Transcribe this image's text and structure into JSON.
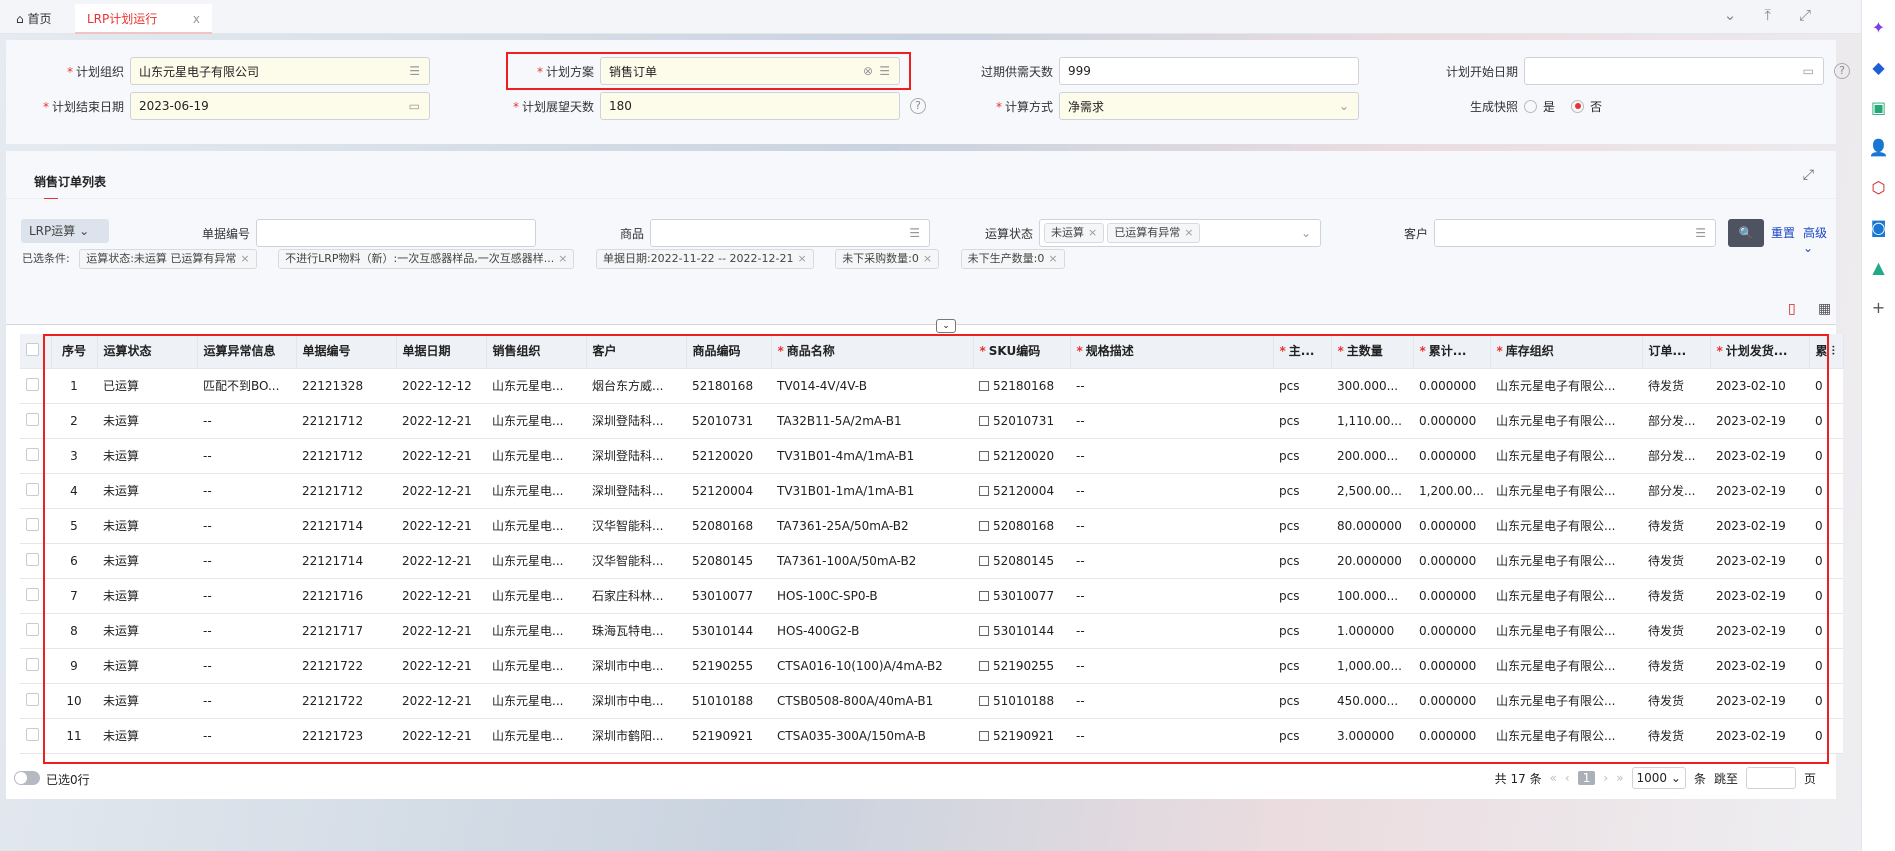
{
  "tabs": {
    "home": "首页",
    "active": "LRP计划运行",
    "close": "x"
  },
  "form": {
    "org_label": "计划组织",
    "org_value": "山东元星电子有限公司",
    "scheme_label": "计划方案",
    "scheme_value": "销售订单",
    "overdue_label": "过期供需天数",
    "overdue_value": "999",
    "start_label": "计划开始日期",
    "start_value": "",
    "end_label": "计划结束日期",
    "end_value": "2023-06-19",
    "horizon_label": "计划展望天数",
    "horizon_value": "180",
    "method_label": "计算方式",
    "method_value": "净需求",
    "snapshot_label": "生成快照",
    "yes": "是",
    "no": "否",
    "snapshot_selected": "否"
  },
  "list": {
    "title": "销售订单列表",
    "lrp_button": "LRP运算",
    "doc_no_label": "单据编号",
    "doc_no_value": "",
    "goods_label": "商品",
    "goods_value": "",
    "status_label": "运算状态",
    "status_tags": [
      "未运算",
      "已运算有异常"
    ],
    "customer_label": "客户",
    "customer_value": "",
    "reset": "重置",
    "advanced": "高级",
    "cond_label": "已选条件:",
    "conditions": [
      "运算状态:未运算 已运算有异常",
      "不进行LRP物料（新）:一次互感器样品,一次互感器样...",
      "单据日期:2022-11-22 -- 2022-12-21",
      "未下采购数量:0",
      "未下生产数量:0"
    ]
  },
  "table": {
    "columns": [
      "序号",
      "运算状态",
      "运算异常信息",
      "单据编号",
      "单据日期",
      "销售组织",
      "客户",
      "商品编码",
      "商品名称",
      "SKU编码",
      "规格描述",
      "主...",
      "主数量",
      "累计...",
      "库存组织",
      "订单...",
      "计划发货...",
      "累"
    ],
    "required": [
      false,
      false,
      false,
      false,
      false,
      false,
      false,
      false,
      true,
      true,
      true,
      true,
      true,
      true,
      true,
      false,
      true,
      false
    ],
    "rows": [
      [
        "1",
        "已运算",
        "匹配不到BO...",
        "22121328",
        "2022-12-12",
        "山东元星电...",
        "烟台东方威...",
        "52180168",
        "TV014-4V/4V-B",
        "52180168",
        "--",
        "pcs",
        "300.000...",
        "0.000000",
        "山东元星电子有限公...",
        "待发货",
        "2023-02-10",
        "0"
      ],
      [
        "2",
        "未运算",
        "--",
        "22121712",
        "2022-12-21",
        "山东元星电...",
        "深圳登陆科...",
        "52010731",
        "TA32B11-5A/2mA-B1",
        "52010731",
        "--",
        "pcs",
        "1,110.00...",
        "0.000000",
        "山东元星电子有限公...",
        "部分发...",
        "2023-02-19",
        "0"
      ],
      [
        "3",
        "未运算",
        "--",
        "22121712",
        "2022-12-21",
        "山东元星电...",
        "深圳登陆科...",
        "52120020",
        "TV31B01-4mA/1mA-B1",
        "52120020",
        "--",
        "pcs",
        "200.000...",
        "0.000000",
        "山东元星电子有限公...",
        "部分发...",
        "2023-02-19",
        "0"
      ],
      [
        "4",
        "未运算",
        "--",
        "22121712",
        "2022-12-21",
        "山东元星电...",
        "深圳登陆科...",
        "52120004",
        "TV31B01-1mA/1mA-B1",
        "52120004",
        "--",
        "pcs",
        "2,500.00...",
        "1,200.00...",
        "山东元星电子有限公...",
        "部分发...",
        "2023-02-19",
        "0"
      ],
      [
        "5",
        "未运算",
        "--",
        "22121714",
        "2022-12-21",
        "山东元星电...",
        "汉华智能科...",
        "52080168",
        "TA7361-25A/50mA-B2",
        "52080168",
        "--",
        "pcs",
        "80.000000",
        "0.000000",
        "山东元星电子有限公...",
        "待发货",
        "2023-02-19",
        "0"
      ],
      [
        "6",
        "未运算",
        "--",
        "22121714",
        "2022-12-21",
        "山东元星电...",
        "汉华智能科...",
        "52080145",
        "TA7361-100A/50mA-B2",
        "52080145",
        "--",
        "pcs",
        "20.000000",
        "0.000000",
        "山东元星电子有限公...",
        "待发货",
        "2023-02-19",
        "0"
      ],
      [
        "7",
        "未运算",
        "--",
        "22121716",
        "2022-12-21",
        "山东元星电...",
        "石家庄科林...",
        "53010077",
        "HOS-100C-SP0-B",
        "53010077",
        "--",
        "pcs",
        "100.000...",
        "0.000000",
        "山东元星电子有限公...",
        "待发货",
        "2023-02-19",
        "0"
      ],
      [
        "8",
        "未运算",
        "--",
        "22121717",
        "2022-12-21",
        "山东元星电...",
        "珠海瓦特电...",
        "53010144",
        "HOS-400G2-B",
        "53010144",
        "--",
        "pcs",
        "1.000000",
        "0.000000",
        "山东元星电子有限公...",
        "待发货",
        "2023-02-19",
        "0"
      ],
      [
        "9",
        "未运算",
        "--",
        "22121722",
        "2022-12-21",
        "山东元星电...",
        "深圳市中电...",
        "52190255",
        "CTSA016-10(100)A/4mA-B2",
        "52190255",
        "--",
        "pcs",
        "1,000.00...",
        "0.000000",
        "山东元星电子有限公...",
        "待发货",
        "2023-02-19",
        "0"
      ],
      [
        "10",
        "未运算",
        "--",
        "22121722",
        "2022-12-21",
        "山东元星电...",
        "深圳市中电...",
        "51010188",
        "CTSB0508-800A/40mA-B1",
        "51010188",
        "--",
        "pcs",
        "450.000...",
        "0.000000",
        "山东元星电子有限公...",
        "待发货",
        "2023-02-19",
        "0"
      ],
      [
        "11",
        "未运算",
        "--",
        "22121723",
        "2022-12-21",
        "山东元星电...",
        "深圳市鹤阳...",
        "52190921",
        "CTSA035-300A/150mA-B",
        "52190921",
        "--",
        "pcs",
        "3.000000",
        "0.000000",
        "山东元星电子有限公...",
        "待发货",
        "2023-02-19",
        "0"
      ]
    ]
  },
  "footer": {
    "selected": "已选0行",
    "total": "共 17 条",
    "page": "1",
    "page_size": "1000",
    "unit": "条",
    "jump": "跳至",
    "page_unit": "页"
  },
  "colors": {
    "accent": "#e8332f",
    "link": "#1a46c9",
    "highlight": "#f01f1f"
  }
}
